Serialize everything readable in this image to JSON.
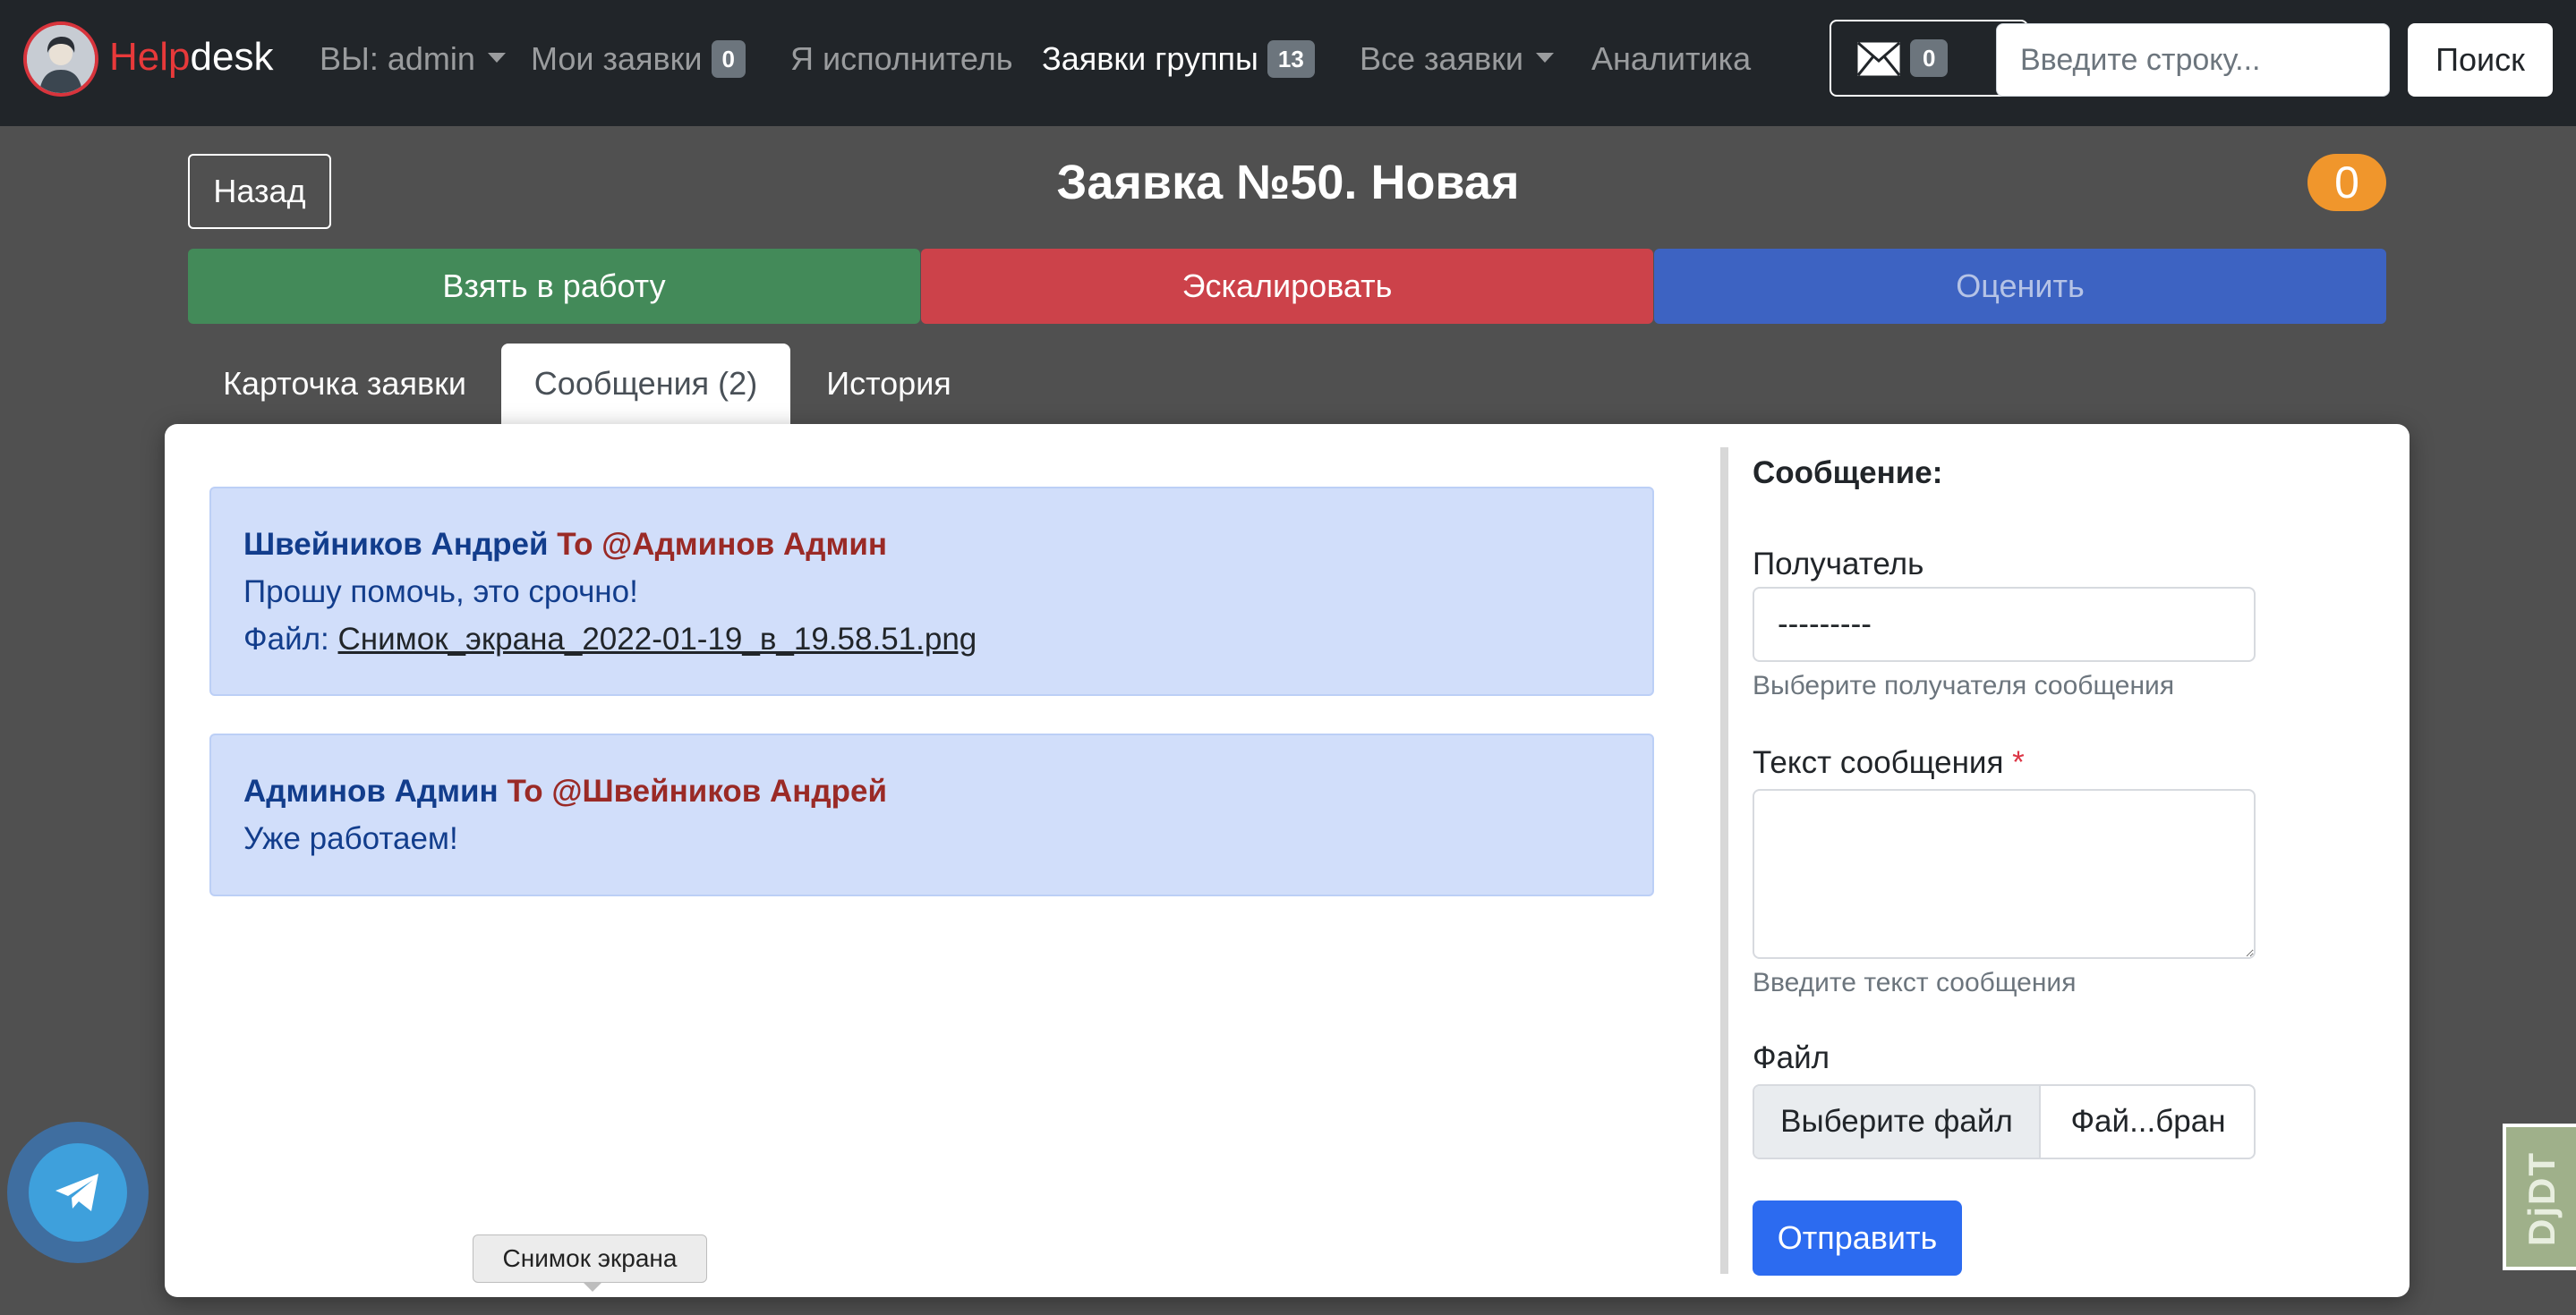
{
  "navbar": {
    "brand_part1": "Help",
    "brand_part2": "desk",
    "items": [
      {
        "label": "ВЫ: admin"
      },
      {
        "label": "Мои заявки",
        "badge": "0"
      },
      {
        "label": "Я исполнитель"
      },
      {
        "label": "Заявки группы",
        "badge": "13"
      },
      {
        "label": "Все заявки"
      },
      {
        "label": "Аналитика"
      }
    ],
    "mail_count": "0",
    "search_placeholder": "Введите строку...",
    "search_button": "Поиск"
  },
  "ticket": {
    "back_button": "Назад",
    "title": "Заявка №50. Новая",
    "rating_badge": "0",
    "actions": {
      "take": "Взять в работу",
      "escalate": "Эскалировать",
      "rate": "Оценить"
    }
  },
  "tabs": [
    {
      "label": "Карточка заявки"
    },
    {
      "label": "Сообщения (2)"
    },
    {
      "label": "История"
    }
  ],
  "messages": [
    {
      "author": "Швейников Андрей",
      "to": "To @Админов Админ",
      "text": "Прошу помочь, это срочно!",
      "file_label": "Файл:",
      "file_name": "Снимок_экрана_2022-01-19_в_19.58.51.png"
    },
    {
      "author": "Админов Админ",
      "to": "To @Швейников Андрей",
      "text": "Уже работаем!"
    }
  ],
  "form": {
    "title": "Сообщение:",
    "recipient_label": "Получатель",
    "recipient_value": "---------",
    "recipient_hint": "Выберите получателя сообщения",
    "text_label": "Текст сообщения",
    "text_required_mark": "*",
    "text_hint": "Введите текст сообщения",
    "file_label": "Файл",
    "file_choose": "Выберите файл",
    "file_status": "Фай...бран",
    "send_button": "Отправить"
  },
  "tooltip": "Снимок экрана",
  "djdt_label": "DjDT",
  "colors": {
    "navbar_bg": "#212529",
    "page_bg": "#505050",
    "take_button": "#438a59",
    "escalate_button": "#cc424a",
    "rate_button": "#3d63c2",
    "rating_badge": "#f0962c",
    "message_bg": "#d1defa",
    "send_button": "#2c6bf0"
  }
}
